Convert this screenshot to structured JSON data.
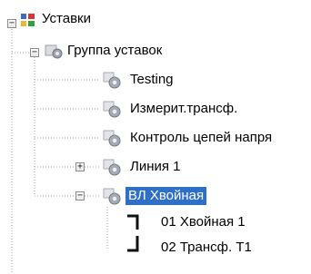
{
  "tree": {
    "root": {
      "label": "Уставки",
      "icon": "settings-folder-icon",
      "expanded": true
    },
    "group": {
      "label": "Группа уставок",
      "icon": "settings-group-icon",
      "expanded": true
    },
    "items": [
      {
        "label": "Testing",
        "icon": "gear-icon"
      },
      {
        "label": "Измерит.трансф.",
        "icon": "gear-icon"
      },
      {
        "label": "Контроль цепей напря",
        "icon": "gear-icon"
      },
      {
        "label": "Линия 1",
        "icon": "gear-icon",
        "expanded": false
      },
      {
        "label": "ВЛ Хвойная",
        "icon": "gear-icon",
        "expanded": true,
        "selected": true
      }
    ],
    "children": [
      {
        "label": "01 Хвойная 1"
      },
      {
        "label": "02 Трансф. Т1"
      }
    ],
    "colors": {
      "selection": "#2f6fc6",
      "tree_line": "#a0a0a0",
      "expander_border": "#8c8c8c"
    }
  }
}
